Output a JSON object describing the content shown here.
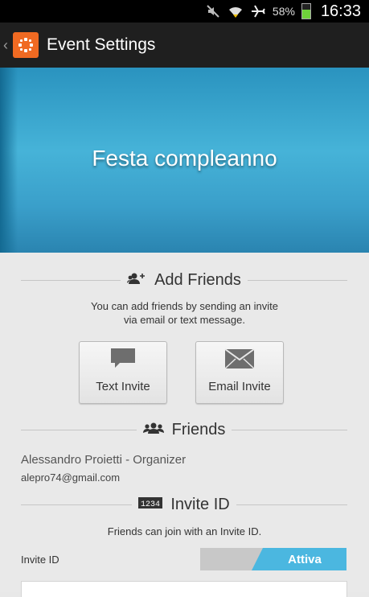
{
  "status_bar": {
    "battery_percent": "58%",
    "time": "16:33",
    "icons": [
      "mute-icon",
      "wifi-icon",
      "airplane-icon",
      "battery-icon"
    ]
  },
  "action_bar": {
    "title": "Event Settings",
    "back_icon": "chevron-left-icon",
    "logo_icon": "app-logo-icon"
  },
  "hero": {
    "event_name": "Festa compleanno"
  },
  "add_friends": {
    "header": "Add Friends",
    "description_line1": "You can add friends by sending an invite",
    "description_line2": "via email or text message.",
    "text_invite_label": "Text Invite",
    "email_invite_label": "Email Invite"
  },
  "friends": {
    "header": "Friends",
    "items": [
      {
        "name": "Alessandro Proietti - Organizer",
        "email": "alepro74@gmail.com"
      }
    ]
  },
  "invite_id": {
    "header": "Invite ID",
    "description": "Friends can join with an Invite ID.",
    "row_label": "Invite ID",
    "toggle_on_label": "Attiva",
    "badge_text": "1234"
  },
  "colors": {
    "accent": "#4bb7e0",
    "brand": "#f06a22",
    "action_bar": "#1f1f1f"
  }
}
